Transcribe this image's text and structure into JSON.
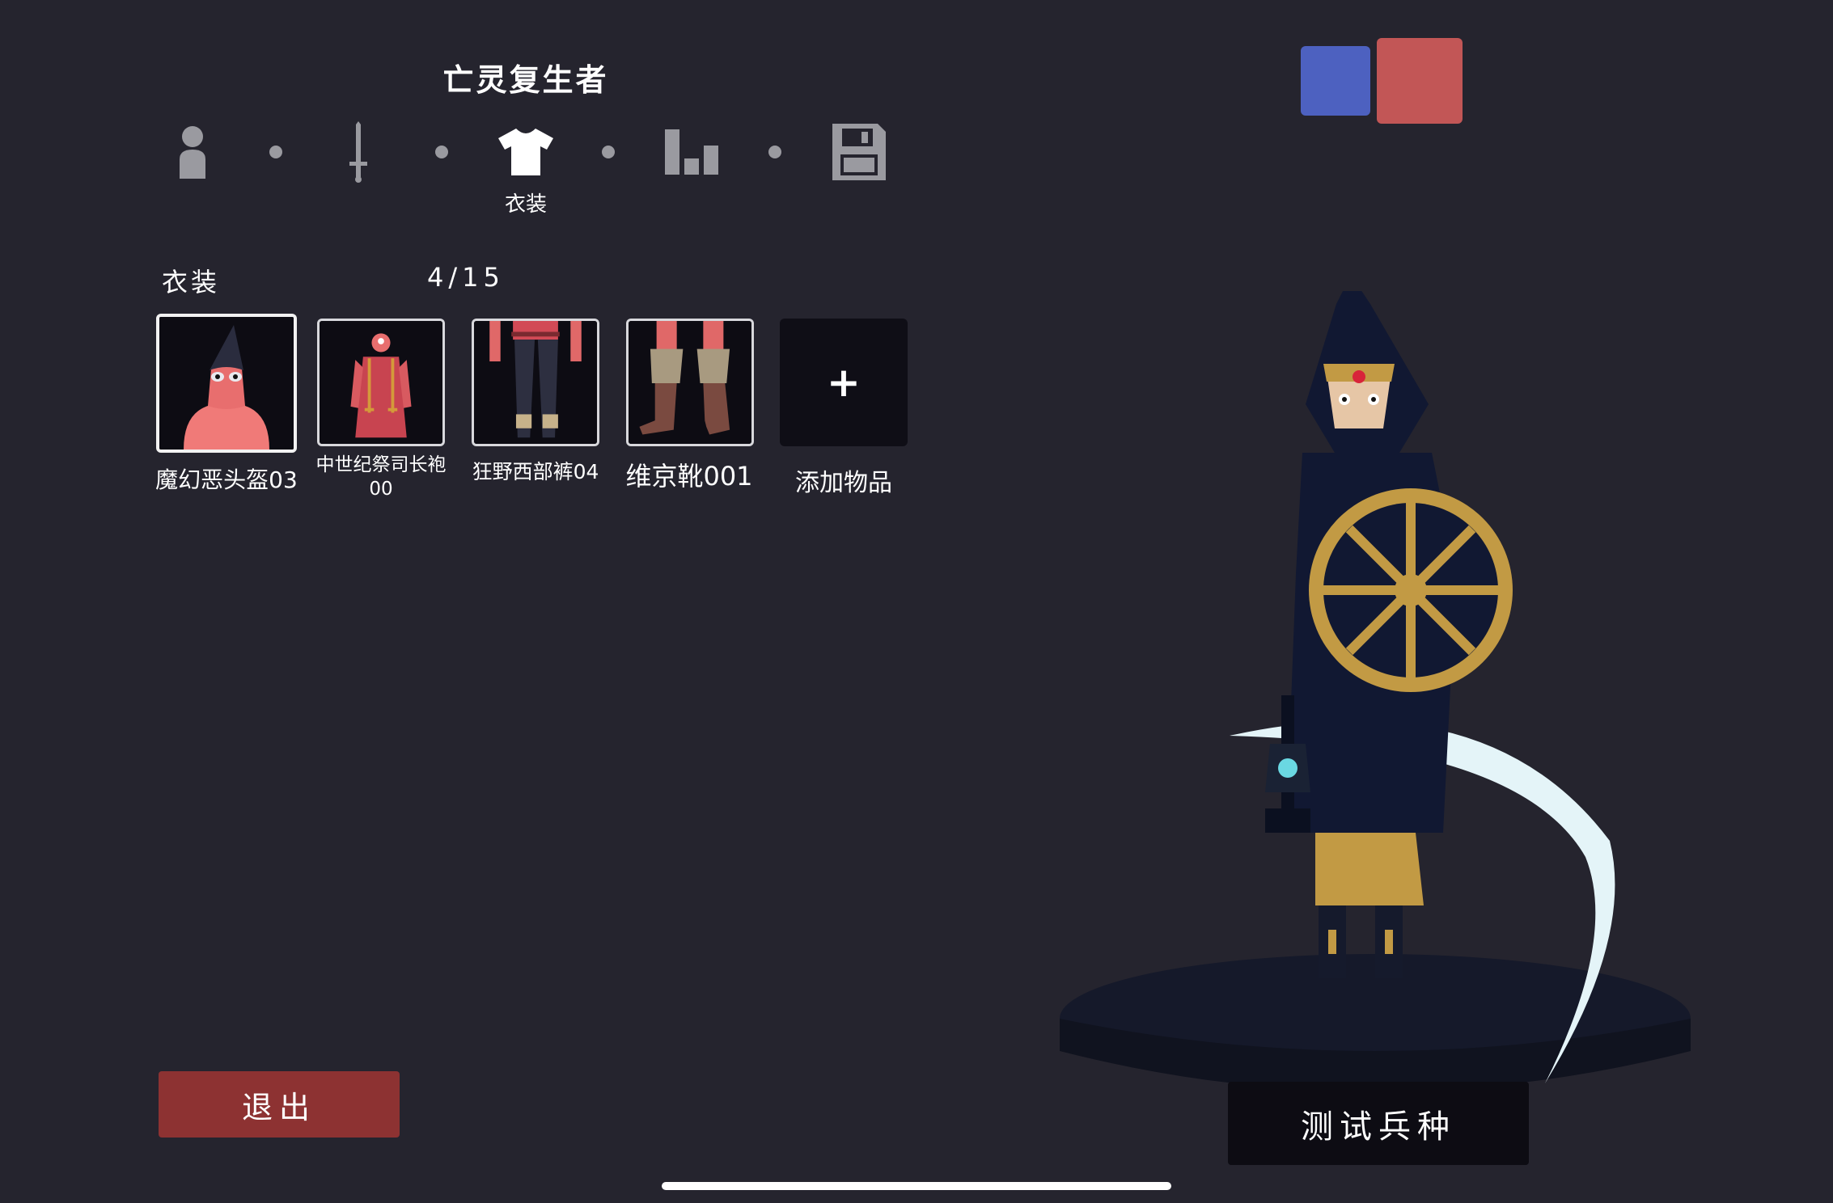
{
  "unit_name": "亡灵复生者",
  "steps": [
    {
      "name": "unit",
      "icon": "person-icon"
    },
    {
      "name": "weapon",
      "icon": "sword-icon"
    },
    {
      "name": "clothing",
      "icon": "shirt-icon",
      "label": "衣装"
    },
    {
      "name": "stats",
      "icon": "bar-chart-icon"
    },
    {
      "name": "save",
      "icon": "floppy-disk-icon"
    }
  ],
  "clothing": {
    "section_label": "衣装",
    "count": "4/15",
    "items": [
      {
        "label": "魔幻恶头盔03",
        "selected": true
      },
      {
        "label": "中世纪祭司长袍00"
      },
      {
        "label": "狂野西部裤04"
      },
      {
        "label": "维京靴001"
      }
    ],
    "add_label": "添加物品",
    "add_symbol": "+"
  },
  "teams": {
    "blue": "#4d61c0",
    "red": "#c25656"
  },
  "buttons": {
    "exit": "退出",
    "test": "测试兵种"
  },
  "colors": {
    "background": "#25242e",
    "exit_button": "#8d3232",
    "slot_bg": "#0d0c13"
  }
}
